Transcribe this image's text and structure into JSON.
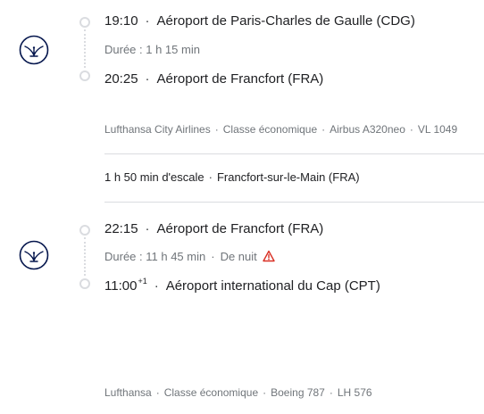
{
  "segments": [
    {
      "departure": {
        "time": "19:10",
        "airport": "Aéroport de Paris-Charles de Gaulle (CDG)"
      },
      "duration": "Durée : 1 h 15 min",
      "arrival": {
        "time": "20:25",
        "day_offset": "",
        "airport": "Aéroport de Francfort (FRA)"
      },
      "details": {
        "airline": "Lufthansa City Airlines",
        "cabin": "Classe économique",
        "aircraft": "Airbus A320neo",
        "flight_number": "VL 1049"
      },
      "airline_icon": "lufthansa-crane-icon"
    },
    {
      "departure": {
        "time": "22:15",
        "airport": "Aéroport de Francfort (FRA)"
      },
      "duration": "Durée : 11 h 45 min",
      "overnight": "De nuit",
      "warning_icon": "warning-triangle-icon",
      "arrival": {
        "time": "11:00",
        "day_offset": "+1",
        "airport": "Aéroport international du Cap (CPT)"
      },
      "details": {
        "airline": "Lufthansa",
        "cabin": "Classe économique",
        "aircraft": "Boeing 787",
        "flight_number": "LH 576"
      },
      "airline_icon": "lufthansa-crane-icon"
    }
  ],
  "layover": {
    "duration": "1 h 50 min d'escale",
    "location": "Francfort-sur-le-Main (FRA)"
  },
  "separator": "·",
  "colors": {
    "primary_text": "#202124",
    "secondary_text": "#70757a",
    "divider": "#dadce0",
    "logo": "#05164d",
    "warning": "#d93025"
  }
}
